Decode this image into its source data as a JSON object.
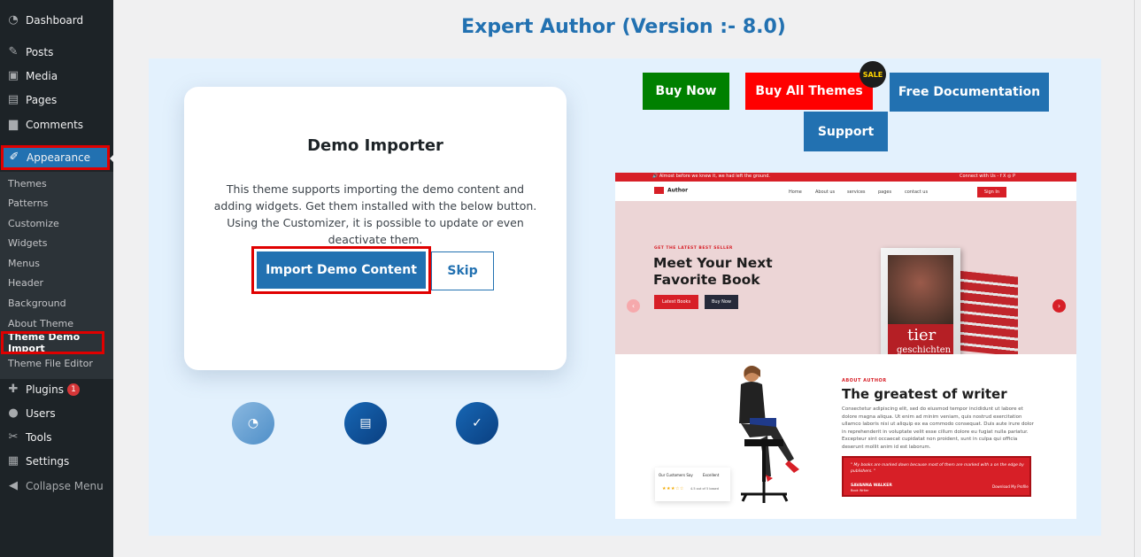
{
  "sidebar": {
    "items": [
      {
        "label": "Dashboard",
        "icon": "dashboard-icon",
        "glyph": "◔"
      },
      {
        "label": "Posts",
        "icon": "pin-icon",
        "glyph": "✎"
      },
      {
        "label": "Media",
        "icon": "media-icon",
        "glyph": "▣"
      },
      {
        "label": "Pages",
        "icon": "pages-icon",
        "glyph": "▤"
      },
      {
        "label": "Comments",
        "icon": "comments-icon",
        "glyph": "▆"
      },
      {
        "label": "Appearance",
        "icon": "paintbrush-icon",
        "glyph": "✐"
      },
      {
        "label": "Plugins",
        "icon": "plugin-icon",
        "glyph": "✚",
        "badge": "1"
      },
      {
        "label": "Users",
        "icon": "users-icon",
        "glyph": "●"
      },
      {
        "label": "Tools",
        "icon": "wrench-icon",
        "glyph": "✂"
      },
      {
        "label": "Settings",
        "icon": "settings-icon",
        "glyph": "▦"
      },
      {
        "label": "Collapse Menu",
        "icon": "collapse-icon",
        "glyph": "◀"
      }
    ],
    "submenu": [
      "Themes",
      "Patterns",
      "Customize",
      "Widgets",
      "Menus",
      "Header",
      "Background",
      "About Theme",
      "Theme Demo Import",
      "Theme File Editor"
    ]
  },
  "main": {
    "title": "Expert Author (Version :- 8.0)",
    "card": {
      "title": "Demo Importer",
      "description": "This theme supports importing the demo content and adding widgets. Get them installed with the below button. Using the Customizer, it is possible to update or even deactivate them.",
      "import_label": "Import Demo Content",
      "skip_label": "Skip"
    },
    "steps": [
      {
        "icon": "dashboard-step-icon",
        "glyph": "◔"
      },
      {
        "icon": "widgets-step-icon",
        "glyph": "▤"
      },
      {
        "icon": "check-step-icon",
        "glyph": "✓"
      }
    ],
    "buttons": {
      "buy_now": "Buy Now",
      "buy_all": "Buy All Themes",
      "sale": "SALE",
      "free_doc": "Free Documentation",
      "support": "Support"
    },
    "preview": {
      "topbar_left": "🔊 Almost before we knew it, we had left the ground.",
      "topbar_right": "Connect with Us -  f  X  ◎  P",
      "logo": "Author",
      "nav": [
        "Home",
        "About us",
        "services",
        "pages",
        "contact us"
      ],
      "signin": "Sign In",
      "kicker": "GET THE LATEST BEST SELLER",
      "headline": "Meet Your Next Favorite Book",
      "latest_books": "Latest Books",
      "buy_now": "Buy Now",
      "book_title_1": "tier",
      "book_title_2": "geschichten",
      "about_kicker": "ABOUT AUTHOR",
      "about_heading": "The greatest of writer",
      "about_text": "Consectetur adipiscing elit, sed do eiusmod tempor incididunt ut labore et dolore magna aliqua. Ut enim ad minim veniam, quis nostrud exercitation ullamco laboris nisi ut aliquip ex ea commodo consequat. Duis aute irure dolor in reprehenderit in voluptate velit esse cillum dolore eu fugiat nulla pariatur. Excepteur sint occaecat cupidatat non proident, sunt in culpa qui officia deserunt mollit anim id est laborum.",
      "quote": "\" My books are marked down because most of them are marked with a on the edge by publishers. \"",
      "quote_name": "SAVANNA WALKER",
      "quote_role": "Book Writer",
      "quote_link": "Download My Profile",
      "review_label": "Our Customers Say",
      "review_excellent": "Excellent",
      "review_stars": "★★★☆☆",
      "review_rating": "4.5 out of 5 based"
    }
  },
  "colors": {
    "accent": "#2271b1",
    "sidebar": "#1d2327",
    "highlight": "#e00000",
    "green": "#008000",
    "red": "#ff0000",
    "preview_red": "#d71f27"
  }
}
